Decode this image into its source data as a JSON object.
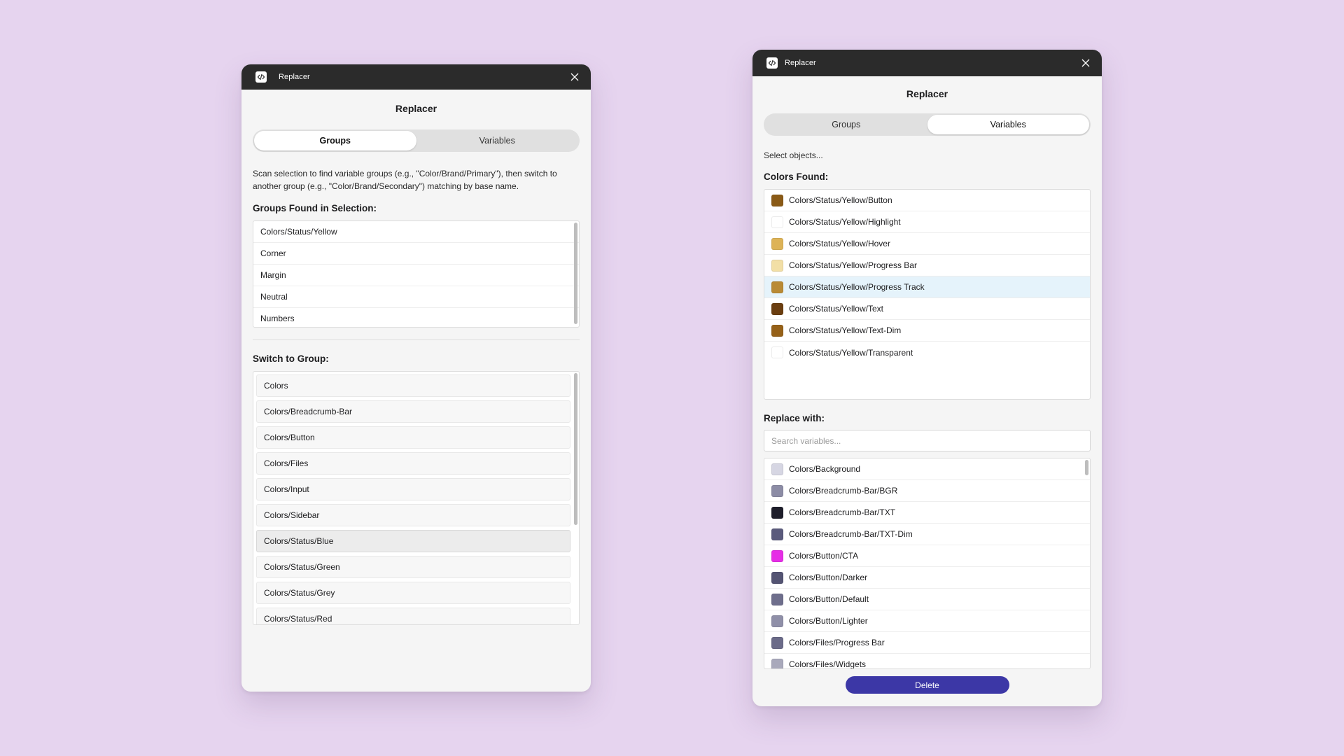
{
  "left": {
    "window_title": "Replacer",
    "panel_title": "Replacer",
    "tabs": [
      {
        "label": "Groups",
        "active": true
      },
      {
        "label": "Variables",
        "active": false
      }
    ],
    "description": "Scan selection to find variable groups (e.g., \"Color/Brand/Primary\"), then switch to another group (e.g., \"Color/Brand/Secondary\") matching by base name.",
    "groups_found_label": "Groups Found in Selection:",
    "groups_found": [
      "Colors/Status/Yellow",
      "Corner",
      "Margin",
      "Neutral",
      "Numbers"
    ],
    "switch_label": "Switch to Group:",
    "switch_groups": [
      {
        "label": "Colors",
        "selected": false
      },
      {
        "label": "Colors/Breadcrumb-Bar",
        "selected": false
      },
      {
        "label": "Colors/Button",
        "selected": false
      },
      {
        "label": "Colors/Files",
        "selected": false
      },
      {
        "label": "Colors/Input",
        "selected": false
      },
      {
        "label": "Colors/Sidebar",
        "selected": false
      },
      {
        "label": "Colors/Status/Blue",
        "selected": true
      },
      {
        "label": "Colors/Status/Green",
        "selected": false
      },
      {
        "label": "Colors/Status/Grey",
        "selected": false
      },
      {
        "label": "Colors/Status/Red",
        "selected": false
      }
    ]
  },
  "right": {
    "window_title": "Replacer",
    "panel_title": "Replacer",
    "tabs": [
      {
        "label": "Groups",
        "active": false
      },
      {
        "label": "Variables",
        "active": true
      }
    ],
    "select_hint": "Select objects...",
    "colors_found_label": "Colors Found:",
    "colors_found": [
      {
        "name": "Colors/Status/Yellow/Button",
        "color": "#8a5a16",
        "highlight": false
      },
      {
        "name": "Colors/Status/Yellow/Highlight",
        "color": "#ffffff",
        "highlight": false
      },
      {
        "name": "Colors/Status/Yellow/Hover",
        "color": "#ddb357",
        "highlight": false
      },
      {
        "name": "Colors/Status/Yellow/Progress Bar",
        "color": "#f2dfa6",
        "highlight": false
      },
      {
        "name": "Colors/Status/Yellow/Progress Track",
        "color": "#b98a35",
        "highlight": true
      },
      {
        "name": "Colors/Status/Yellow/Text",
        "color": "#6b3e10",
        "highlight": false
      },
      {
        "name": "Colors/Status/Yellow/Text-Dim",
        "color": "#966118",
        "highlight": false
      },
      {
        "name": "Colors/Status/Yellow/Transparent",
        "color": "#ffffff",
        "highlight": false
      }
    ],
    "replace_label": "Replace with:",
    "search_placeholder": "Search variables...",
    "replace_options": [
      {
        "name": "Colors/Background",
        "color": "#d6d6e3"
      },
      {
        "name": "Colors/Breadcrumb-Bar/BGR",
        "color": "#8c8ca5"
      },
      {
        "name": "Colors/Breadcrumb-Bar/TXT",
        "color": "#1e1e2b"
      },
      {
        "name": "Colors/Breadcrumb-Bar/TXT-Dim",
        "color": "#5a5a7c"
      },
      {
        "name": "Colors/Button/CTA",
        "color": "#e62ee6"
      },
      {
        "name": "Colors/Button/Darker",
        "color": "#545473"
      },
      {
        "name": "Colors/Button/Default",
        "color": "#6e6e8c"
      },
      {
        "name": "Colors/Button/Lighter",
        "color": "#8f8fa8"
      },
      {
        "name": "Colors/Files/Progress Bar",
        "color": "#6b6b89"
      },
      {
        "name": "Colors/Files/Widgets",
        "color": "#a9a9bb"
      }
    ],
    "delete_label": "Delete"
  }
}
